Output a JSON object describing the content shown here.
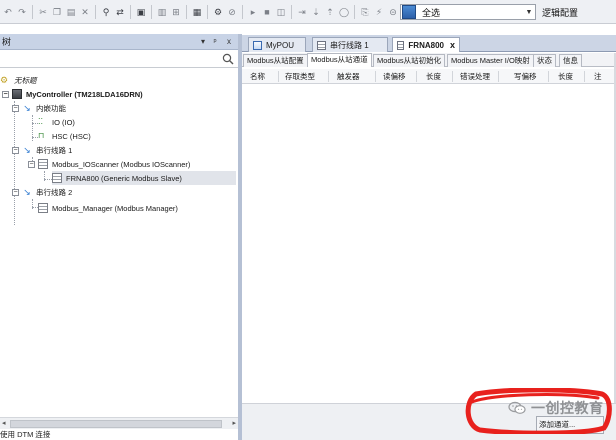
{
  "toolbar": {
    "scope_value": "全选",
    "logic_config_label": "逻辑配置"
  },
  "left_panel": {
    "title": "树",
    "pin": "ᵖ",
    "close": "x",
    "tree": [
      {
        "label": "无标题"
      },
      {
        "label": "MyController (TM218LDA16DRN)"
      },
      {
        "label": "内嵌功能"
      },
      {
        "label": "IO (IO)"
      },
      {
        "label": "HSC (HSC)"
      },
      {
        "label": "串行线路 1"
      },
      {
        "label": "Modbus_IOScanner (Modbus IOScanner)"
      },
      {
        "label": "FRNA800 (Generic Modbus Slave)"
      },
      {
        "label": "串行线路 2"
      },
      {
        "label": "Modbus_Manager (Modbus Manager)"
      }
    ],
    "status": "使用 DTM 连接"
  },
  "editor": {
    "doc_tabs": [
      {
        "label": "MyPOU"
      },
      {
        "label": "串行线路 1"
      },
      {
        "label": "FRNA800",
        "close": "x"
      }
    ],
    "sub_tabs": [
      {
        "label": "Modbus从站配置"
      },
      {
        "label": "Modbus从站通道"
      },
      {
        "label": "Modbus从站初始化"
      },
      {
        "label": "Modbus Master I/O映射"
      },
      {
        "label": "状态"
      },
      {
        "label": "信息"
      }
    ],
    "columns": [
      "名称",
      "存取类型",
      "触发器",
      "读偏移",
      "长度",
      "错误处理",
      "写偏移",
      "长度",
      "注"
    ],
    "add_channel_label": "添加通道..."
  },
  "watermark": {
    "text": "一创控教育"
  },
  "colors": {
    "annotation": "#e8211d",
    "tab_strip": "#ccd5e5",
    "panel_header": "#c8d3e6"
  }
}
